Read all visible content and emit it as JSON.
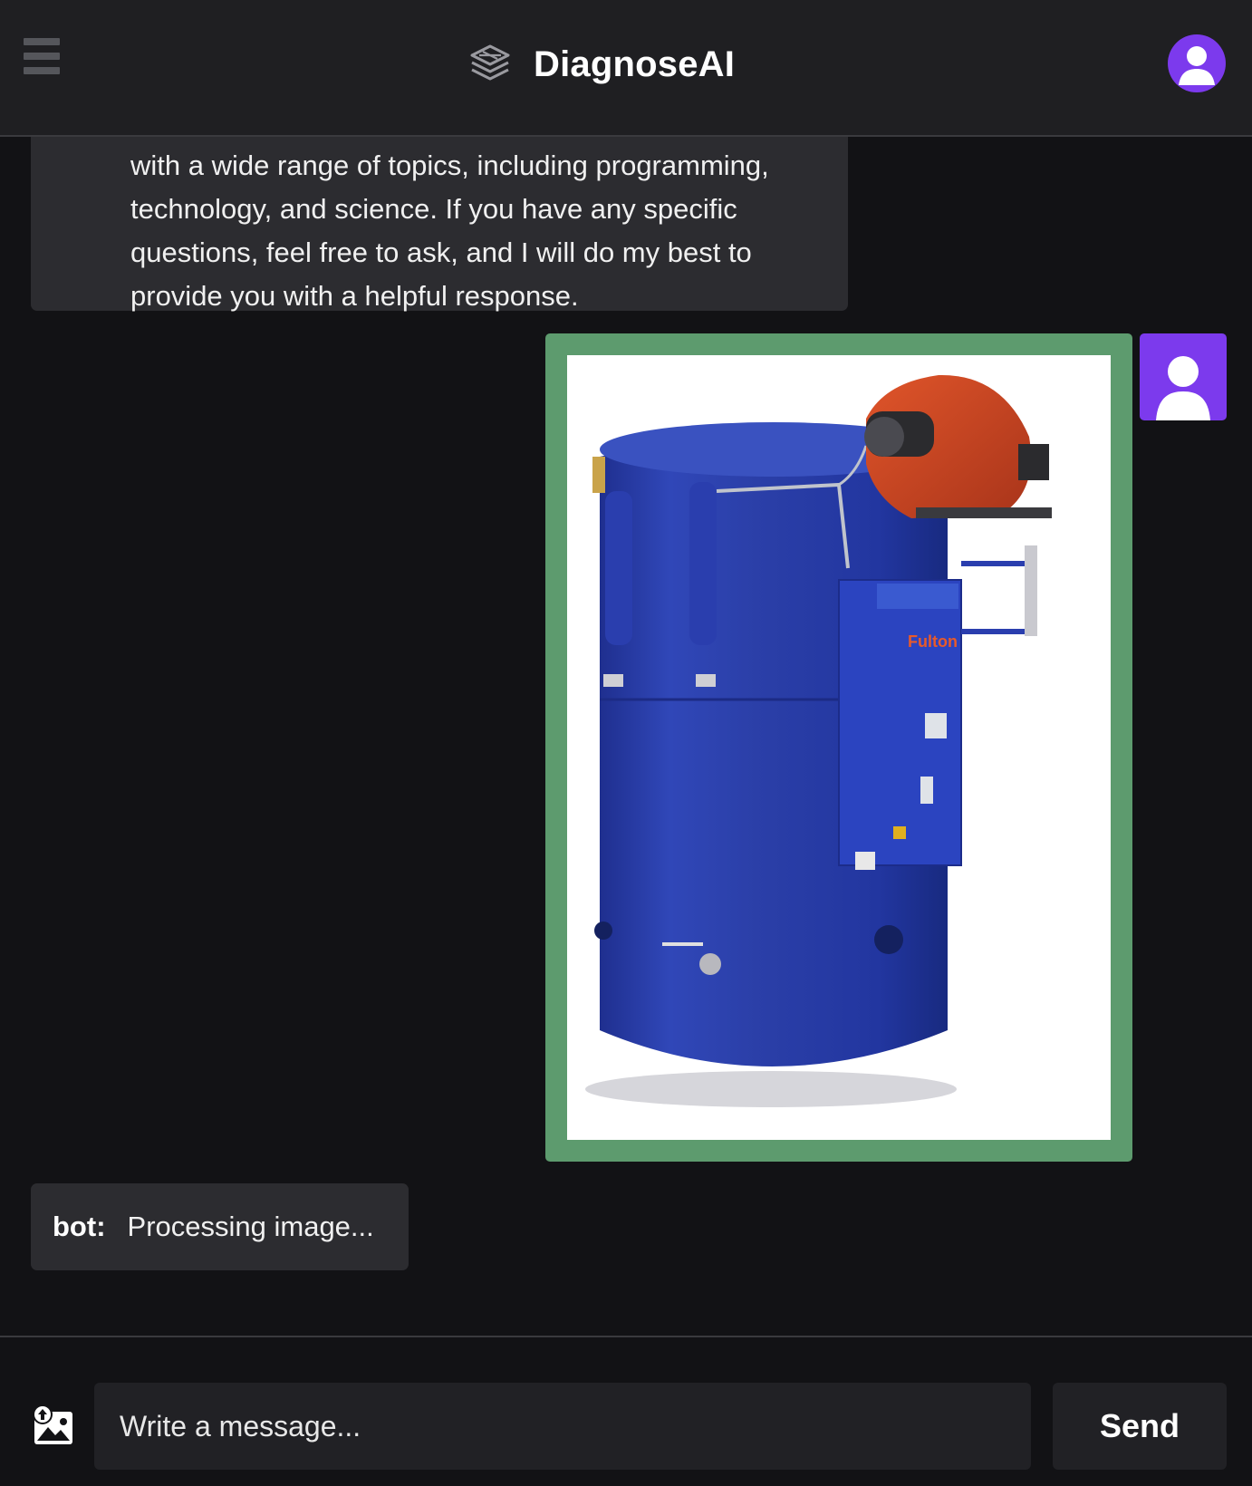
{
  "header": {
    "app_name": "DiagnoseAI",
    "menu_icon": "hamburger-menu-icon",
    "logo_icon": "stacked-layers-icon",
    "avatar_icon": "user-avatar-icon"
  },
  "messages": [
    {
      "role": "bot",
      "partial": true,
      "lines": [
        "with a wide range of topics, including programming,",
        "technology, and science. If you have any specific",
        "questions, feel free to ask, and I will do my best to",
        "provide you with a helpful response."
      ]
    },
    {
      "role": "user",
      "type": "image",
      "image_text": "Fulton",
      "avatar_icon": "user-avatar-icon"
    },
    {
      "role": "bot",
      "sender_label": "bot:",
      "text": "Processing image..."
    }
  ],
  "composer": {
    "upload_icon": "image-upload-icon",
    "placeholder": "Write a message...",
    "send_label": "Send"
  },
  "colors": {
    "background": "#121215",
    "header": "#1f1f22",
    "bubble": "#2c2c30",
    "image_frame": "#5d9b6e",
    "avatar": "#7c3aed",
    "input": "#212125"
  }
}
